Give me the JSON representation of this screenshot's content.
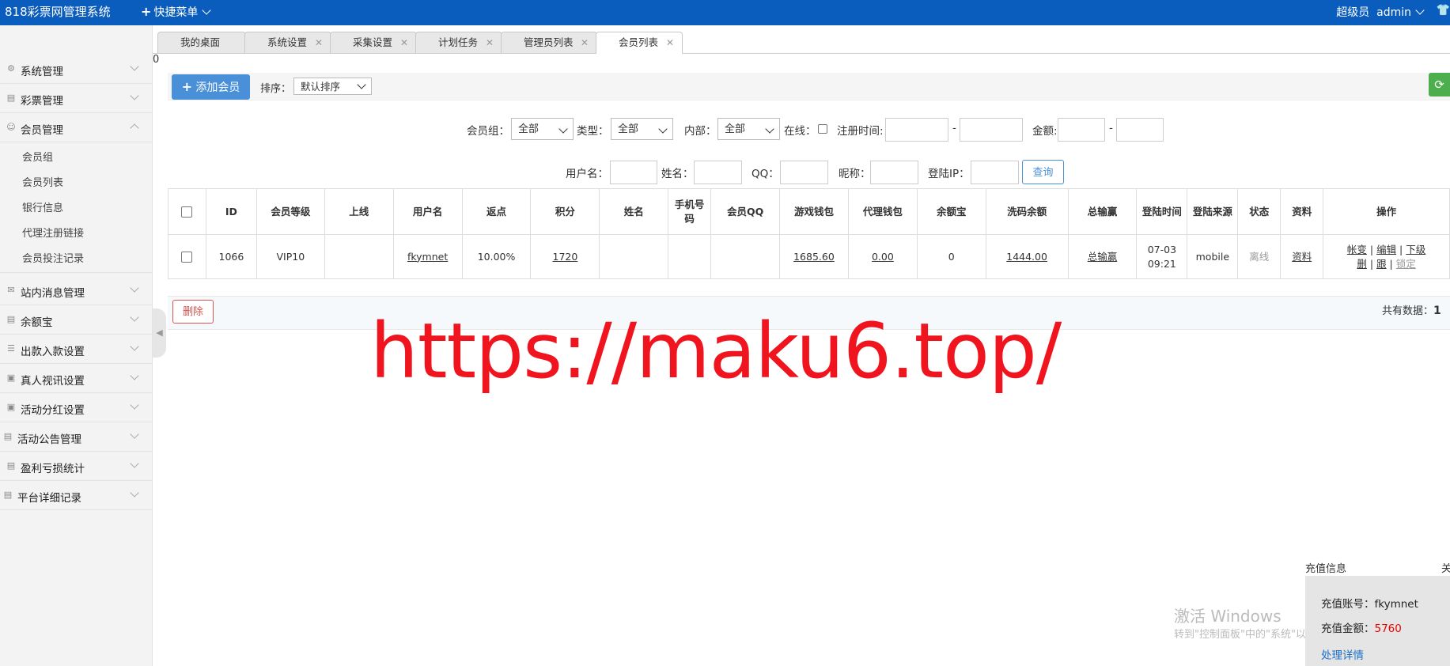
{
  "header": {
    "brand": "818彩票网管理系统",
    "quick_menu": "快捷菜单",
    "role": "超级员",
    "user": "admin"
  },
  "sidebar": {
    "items": [
      {
        "label": "系统管理",
        "icon": "gear-icon"
      },
      {
        "label": "彩票管理",
        "icon": "bar-chart-icon"
      },
      {
        "label": "会员管理",
        "icon": "user-icon",
        "expanded": true
      }
    ],
    "sub_items": [
      "会员组",
      "会员列表",
      "银行信息",
      "代理注册链接",
      "会员投注记录"
    ],
    "items_after": [
      {
        "label": "站内消息管理",
        "icon": "mail-icon"
      },
      {
        "label": "余额宝",
        "icon": "bar-chart-icon"
      },
      {
        "label": "出款入款设置",
        "icon": "list-icon"
      },
      {
        "label": "真人视讯设置",
        "icon": "id-card-icon"
      },
      {
        "label": "活动分红设置",
        "icon": "card-icon"
      },
      {
        "label": "活动公告管理",
        "icon": "document-icon"
      },
      {
        "label": "盈利亏损统计",
        "icon": "bar-chart-icon"
      },
      {
        "label": "平台详细记录",
        "icon": "document-icon"
      }
    ]
  },
  "tabs": [
    {
      "label": "我的桌面",
      "closable": false
    },
    {
      "label": "系统设置",
      "closable": true
    },
    {
      "label": "采集设置",
      "closable": true
    },
    {
      "label": "计划任务",
      "closable": true
    },
    {
      "label": "管理员列表",
      "closable": true
    },
    {
      "label": "会员列表",
      "closable": true,
      "active": true
    }
  ],
  "stray_text": "0",
  "toolbar": {
    "add_label": "添加会员",
    "sort_label": "排序：",
    "sort_value": "默认排序"
  },
  "filters": {
    "group_label": "会员组：",
    "group_value": "全部",
    "type_label": "类型：",
    "type_value": "全部",
    "internal_label": "内部：",
    "internal_value": "全部",
    "online_label": "在线：",
    "regtime_label": "注册时间:",
    "dash": "-",
    "amount_label": "金额:",
    "username_label": "用户名：",
    "name_label": "姓名：",
    "qq_label": "QQ：",
    "nickname_label": "昵称：",
    "loginip_label": "登陆IP：",
    "query_label": "查询"
  },
  "table": {
    "headers": [
      "ID",
      "会员等级",
      "上线",
      "用户名",
      "返点",
      "积分",
      "姓名",
      "手机号码",
      "会员QQ",
      "游戏钱包",
      "代理钱包",
      "余额宝",
      "洗码余额",
      "总输赢",
      "登陆时间",
      "登陆来源",
      "状态",
      "资料",
      "操作"
    ],
    "row": {
      "id": "1066",
      "level": "VIP10",
      "upline": "",
      "username": "fkymnet",
      "rebate": "10.00%",
      "points": "1720",
      "name": "",
      "phone": "",
      "qq": "",
      "game_wallet": "1685.60",
      "agent_wallet": "0.00",
      "yuebao": "0",
      "wash": "1444.00",
      "total_wl": "总输赢",
      "login_time": "07-03 09:21",
      "login_source": "mobile",
      "status": "离线",
      "profile": "资料",
      "ops": [
        "帐变",
        "编辑",
        "下级",
        "删",
        "跟",
        "锁定"
      ]
    }
  },
  "footer": {
    "delete_label": "删除",
    "total_label": "共有数据：",
    "total_count": "1"
  },
  "watermark": "https://maku6.top/",
  "windows_activate": {
    "line1": "激活 Windows",
    "line2": "转到\"控制面板\"中的\"系统\"以激活 Windows。"
  },
  "recharge": {
    "title": "充值信息",
    "close": "关",
    "account_label": "充值账号：",
    "account": "fkymnet",
    "amount_label": "充值金额：",
    "amount": "5760",
    "detail": "处理详情"
  },
  "colors": {
    "header_bg": "#0b5dbd",
    "primary": "#4a90d9",
    "danger": "#d9534f",
    "success": "#4cae4c",
    "watermark": "#f0141e"
  }
}
